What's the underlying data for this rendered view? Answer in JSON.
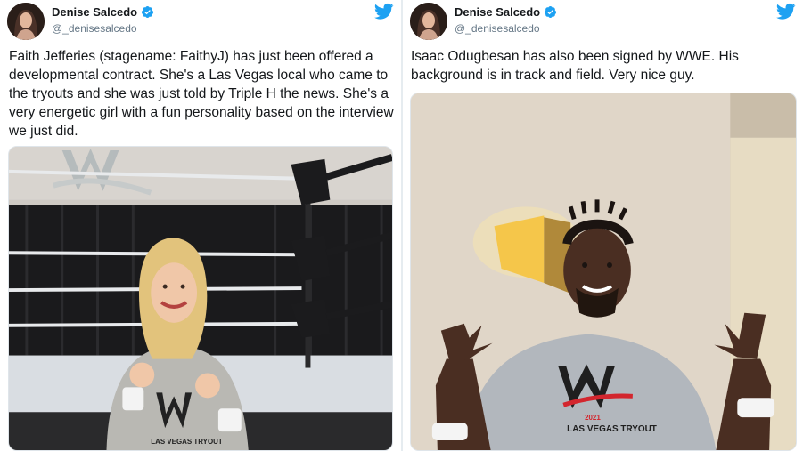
{
  "tweets": [
    {
      "author": {
        "name": "Denise Salcedo",
        "handle": "@_denisesalcedo"
      },
      "text": "Faith Jefferies (stagename: FaithyJ) has just been offered a developmental contract. She's a Las Vegas local who came to the tryouts and she was just told by Triple H the news. She's a very energetic girl with a fun personality based on the interview we just did.",
      "media": {
        "shirt_text": "LAS VEGAS TRYOUT"
      }
    },
    {
      "author": {
        "name": "Denise Salcedo",
        "handle": "@_denisesalcedo"
      },
      "text": "Isaac Odugbesan has also been signed by WWE. His background is in track and field. Very nice guy.",
      "media": {
        "shirt_year": "2021",
        "shirt_text": "LAS VEGAS TRYOUT"
      }
    }
  ],
  "colors": {
    "twitter_blue": "#1da1f2",
    "text": "#14171a",
    "handle": "#657786"
  },
  "icons": {
    "verified": "verified-badge-icon",
    "brand": "twitter-bird-icon"
  }
}
